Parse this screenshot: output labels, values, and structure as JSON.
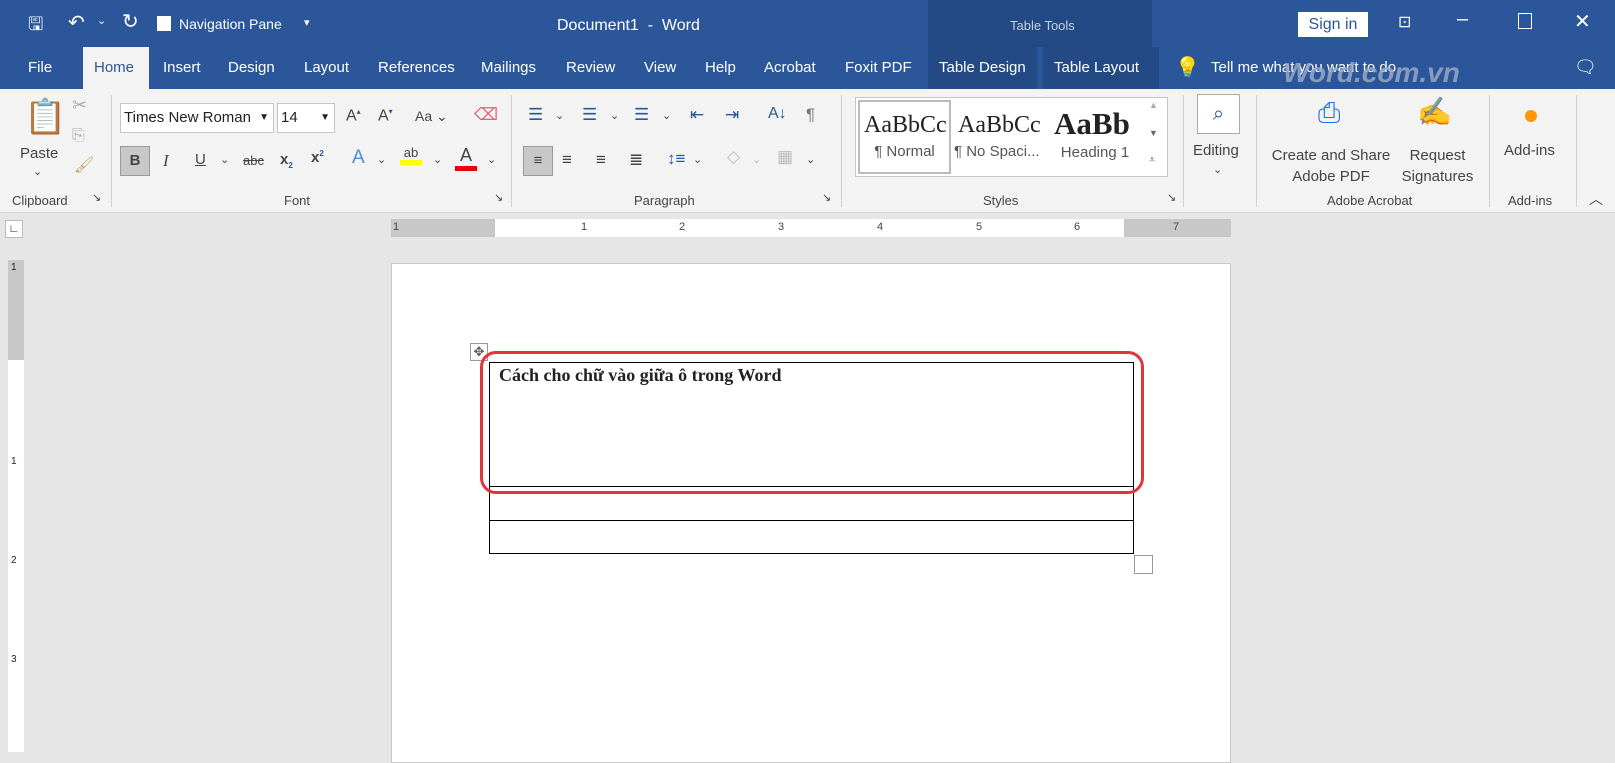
{
  "titlebar": {
    "qat_nav_pane": "Navigation Pane",
    "title": "Document1  -  Word",
    "table_tools": "Table Tools",
    "sign_in": "Sign in"
  },
  "tabs": [
    "File",
    "Home",
    "Insert",
    "Design",
    "Layout",
    "References",
    "Mailings",
    "Review",
    "View",
    "Help",
    "Acrobat",
    "Foxit PDF",
    "Table Design",
    "Table Layout"
  ],
  "tell_me": "Tell me what you want to do",
  "watermark": "Word.com.vn",
  "ribbon": {
    "clipboard": {
      "paste": "Paste",
      "label": "Clipboard"
    },
    "font": {
      "name": "Times New Roman",
      "size": "14",
      "label": "Font",
      "change_case": "Aa"
    },
    "paragraph": {
      "label": "Paragraph"
    },
    "styles": {
      "label": "Styles",
      "items": [
        {
          "preview": "AaBbCc",
          "name": "¶ Normal"
        },
        {
          "preview": "AaBbCc",
          "name": "¶ No Spaci..."
        },
        {
          "preview": "AaBb",
          "name": "Heading 1"
        }
      ]
    },
    "editing": {
      "label": "Editing"
    },
    "acrobat": {
      "create": "Create and Share",
      "create2": "Adobe PDF",
      "request": "Request",
      "request2": "Signatures",
      "label": "Adobe Acrobat"
    },
    "addins": {
      "button": "Add-ins",
      "label": "Add-ins"
    }
  },
  "ruler": {
    "numbers": [
      "1",
      "1",
      "2",
      "3",
      "4",
      "5",
      "6",
      "7"
    ]
  },
  "vruler": {
    "numbers": [
      "1",
      "1",
      "2",
      "3"
    ]
  },
  "document": {
    "cell_text": "Cách cho chữ vào giữa ô trong Word"
  },
  "colors": {
    "brand": "#2b579a",
    "highlight": "#e0353b"
  }
}
